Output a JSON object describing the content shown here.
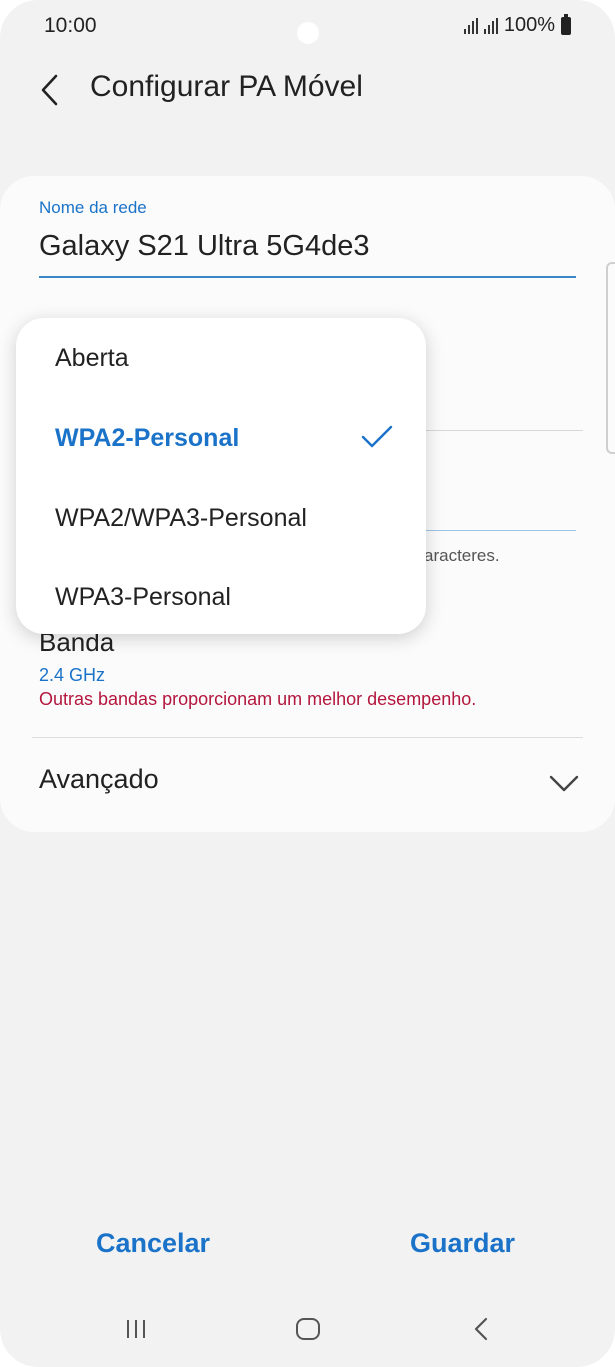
{
  "status_bar": {
    "time": "10:00",
    "battery_text": "100%"
  },
  "header": {
    "title": "Configurar PA Móvel"
  },
  "network_name": {
    "label": "Nome da rede",
    "value": "Galaxy S21 Ultra 5G4de3"
  },
  "password_hint_partial": "aracteres.",
  "security_menu": {
    "options": [
      "Aberta",
      "WPA2-Personal",
      "WPA2/WPA3-Personal",
      "WPA3-Personal"
    ],
    "selected": "WPA2-Personal"
  },
  "band": {
    "label": "Banda",
    "value": "2.4 GHz",
    "warning": "Outras bandas proporcionam um melhor desempenho."
  },
  "advanced": {
    "label": "Avançado"
  },
  "buttons": {
    "cancel": "Cancelar",
    "save": "Guardar"
  },
  "colors": {
    "accent": "#1a73c8",
    "warning": "#b3173d",
    "background": "#f2f2f2",
    "card": "#fbfbfb"
  },
  "icons": [
    "back-icon",
    "check-icon",
    "chevron-down-icon",
    "recent-apps-icon",
    "home-icon",
    "nav-back-icon",
    "signal-icon",
    "battery-icon"
  ]
}
